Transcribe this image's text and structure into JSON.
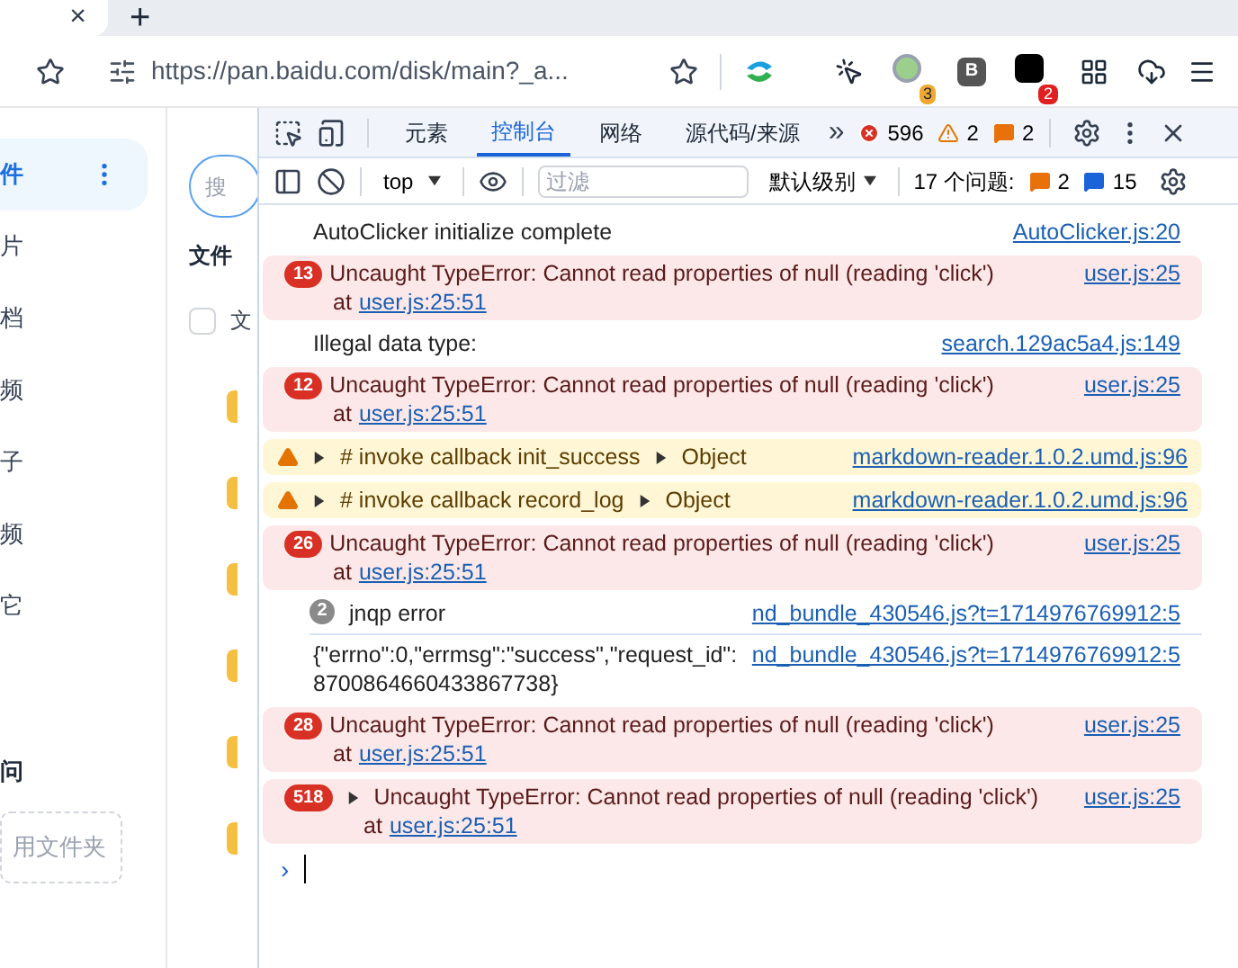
{
  "browser": {
    "tab_close": "×",
    "new_tab": "+",
    "url": "https://pan.baidu.com/disk/main?_a...",
    "extensions": [
      {
        "kind": "cursor"
      },
      {
        "kind": "avatar",
        "badge": "3"
      },
      {
        "kind": "letter",
        "label": "B"
      },
      {
        "kind": "dark",
        "badge": "2"
      },
      {
        "kind": "grid"
      },
      {
        "kind": "cloud"
      }
    ]
  },
  "page": {
    "sidebar": [
      {
        "label": "件",
        "selected": true
      },
      {
        "label": "片",
        "selected": false
      },
      {
        "label": "档",
        "selected": false
      },
      {
        "label": "频",
        "selected": false
      },
      {
        "label": "子",
        "selected": false
      },
      {
        "label": "频",
        "selected": false
      },
      {
        "label": "它",
        "selected": false
      }
    ],
    "section_title": "问",
    "folder_button": "用文件夹",
    "search_placeholder": "搜",
    "column_header": "文件",
    "row_label": "文",
    "row_checked": false
  },
  "devtools": {
    "tabs": [
      {
        "label": "元素",
        "selected": false
      },
      {
        "label": "控制台",
        "selected": true
      },
      {
        "label": "网络",
        "selected": false
      },
      {
        "label": "源代码/来源",
        "selected": false
      }
    ],
    "more_tabs": "»",
    "errors": "596",
    "warnings": "2",
    "issues": "2",
    "context": "top",
    "filter_placeholder": "过滤",
    "level": "默认级别",
    "issues_label": "17 个问题:",
    "issue_counts": [
      "2",
      "15"
    ],
    "messages": [
      {
        "kind": "log",
        "text": "AutoClicker initialize complete",
        "source": "AutoClicker.js:20"
      },
      {
        "kind": "error",
        "count": "13",
        "expandable": false,
        "text": "Uncaught TypeError: Cannot read properties of null (reading 'click')",
        "source": "user.js:25",
        "at": "at",
        "location": "user.js:25:51"
      },
      {
        "kind": "log",
        "text": "Illegal data type:",
        "source": "search.129ac5a4.js:149"
      },
      {
        "kind": "error",
        "count": "12",
        "expandable": false,
        "text": "Uncaught TypeError: Cannot read properties of null (reading 'click')",
        "source": "user.js:25",
        "at": "at",
        "location": "user.js:25:51"
      },
      {
        "kind": "warning",
        "text": "# invoke callback init_success",
        "object": "Object",
        "source": "markdown-reader.1.0.2.umd.js:96"
      },
      {
        "kind": "warning",
        "text": "# invoke callback record_log",
        "object": "Object",
        "source": "markdown-reader.1.0.2.umd.js:96"
      },
      {
        "kind": "error",
        "count": "26",
        "expandable": false,
        "text": "Uncaught TypeError: Cannot read properties of null (reading 'click')",
        "source": "user.js:25",
        "at": "at",
        "location": "user.js:25:51"
      },
      {
        "kind": "log",
        "count": "2",
        "text": "jnqp error",
        "source": "nd_bundle_430546.js?t=1714976769912:5"
      },
      {
        "kind": "log",
        "text": "{\"errno\":0,\"errmsg\":\"success\",\"request_id\":8700864660433867738}",
        "source": "nd_bundle_430546.js?t=1714976769912:5"
      },
      {
        "kind": "error",
        "count": "28",
        "expandable": false,
        "text": "Uncaught TypeError: Cannot read properties of null (reading 'click')",
        "source": "user.js:25",
        "at": "at",
        "location": "user.js:25:51"
      },
      {
        "kind": "error",
        "count": "518",
        "expandable": true,
        "text": "Uncaught TypeError: Cannot read properties of null (reading 'click')",
        "source": "user.js:25",
        "at": "at",
        "location": "user.js:25:51"
      }
    ],
    "prompt": "›"
  }
}
